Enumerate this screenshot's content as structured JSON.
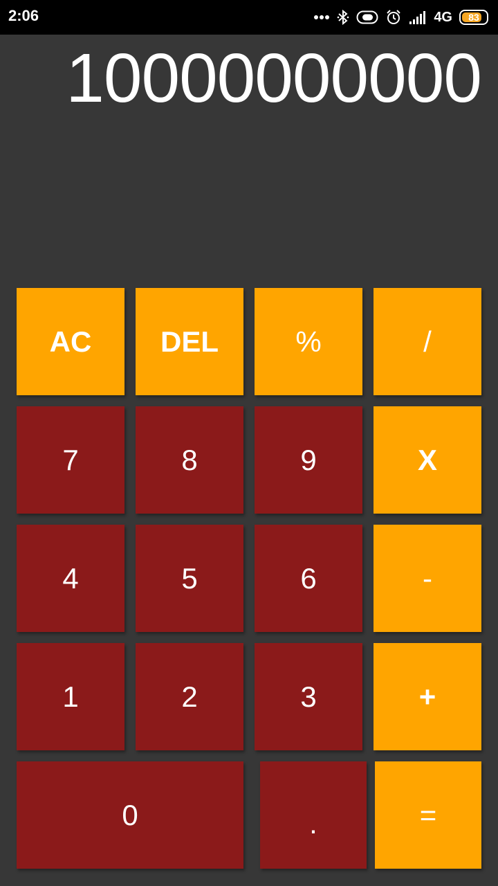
{
  "status_bar": {
    "time": "2:06",
    "network": "4G",
    "battery_level": "83",
    "battery_color": "#f5a623",
    "icons": [
      "more-dots-icon",
      "bluetooth-icon",
      "toggle-icon",
      "alarm-icon",
      "signal-icon",
      "battery-icon"
    ]
  },
  "display": {
    "value": "10000000000"
  },
  "keypad": {
    "colors": {
      "operator": "#ffa500",
      "number": "#8b1a1a",
      "background": "#373737"
    },
    "row1": {
      "ac": "AC",
      "del": "DEL",
      "percent": "%",
      "divide": "/"
    },
    "row2": {
      "seven": "7",
      "eight": "8",
      "nine": "9",
      "multiply": "X"
    },
    "row3": {
      "four": "4",
      "five": "5",
      "six": "6",
      "minus": "-"
    },
    "row4": {
      "one": "1",
      "two": "2",
      "three": "3",
      "plus": "+"
    },
    "row5": {
      "zero": "0",
      "dot": ".",
      "equals": "="
    }
  }
}
